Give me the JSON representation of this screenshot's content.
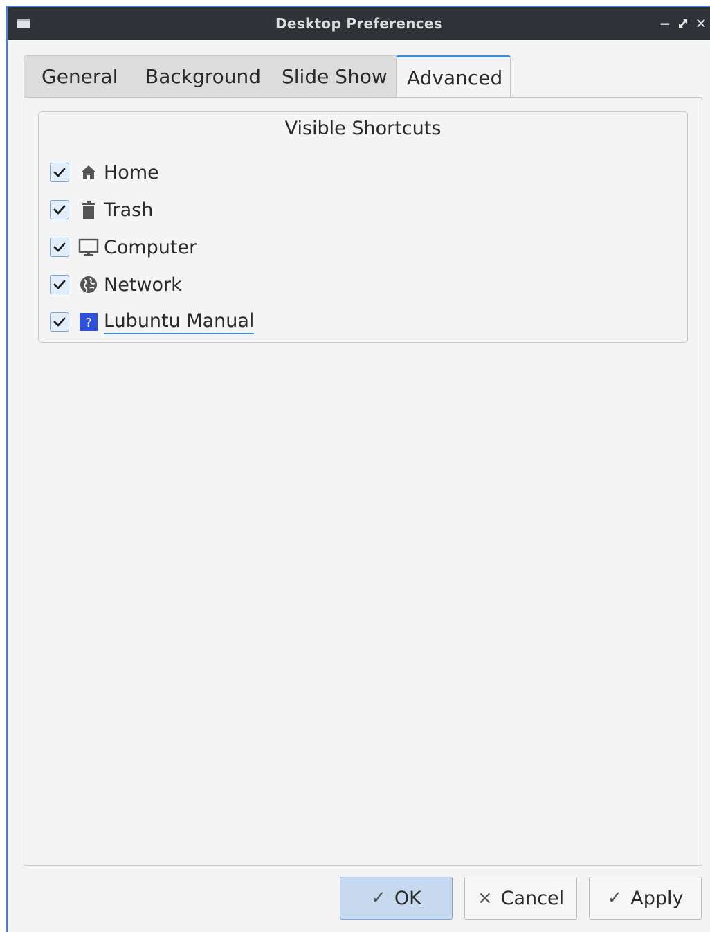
{
  "window": {
    "title": "Desktop Preferences",
    "controls": {
      "minimize": "−",
      "maximize": "⤢",
      "close": "✕"
    }
  },
  "tabs": [
    {
      "label": "General",
      "active": false
    },
    {
      "label": "Background",
      "active": false
    },
    {
      "label": "Slide Show",
      "active": false
    },
    {
      "label": "Advanced",
      "active": true
    }
  ],
  "visible_shortcuts": {
    "title": "Visible Shortcuts",
    "items": [
      {
        "label": "Home",
        "checked": true,
        "icon": "home-icon"
      },
      {
        "label": "Trash",
        "checked": true,
        "icon": "trash-icon"
      },
      {
        "label": "Computer",
        "checked": true,
        "icon": "computer-icon"
      },
      {
        "label": "Network",
        "checked": true,
        "icon": "network-icon"
      },
      {
        "label": "Lubuntu Manual",
        "checked": true,
        "icon": "help-icon",
        "focused": true
      }
    ]
  },
  "buttons": {
    "ok": {
      "label": "OK",
      "icon": "✓"
    },
    "cancel": {
      "label": "Cancel",
      "icon": "×"
    },
    "apply": {
      "label": "Apply",
      "icon": "✓"
    }
  },
  "colors": {
    "accent": "#3b8be0",
    "titlebar": "#2f3338",
    "window_bg": "#f4f4f4",
    "help_icon": "#3050d8"
  }
}
